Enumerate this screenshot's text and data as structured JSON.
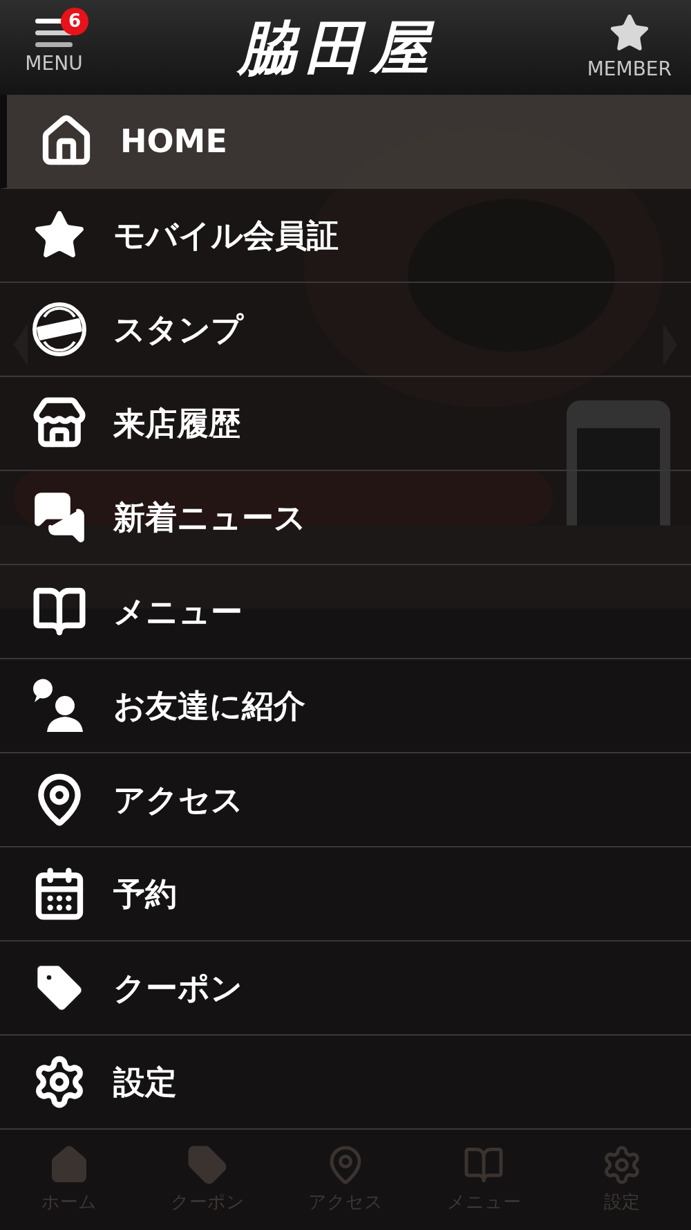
{
  "header": {
    "menu_label": "MENU",
    "badge": "6",
    "logo": "脇田屋",
    "member_label": "MEMBER"
  },
  "menu": [
    {
      "kind": "home",
      "label": "HOME",
      "selected": true
    },
    {
      "kind": "card",
      "label": "モバイル会員証",
      "selected": false
    },
    {
      "kind": "stamp",
      "label": "スタンプ",
      "selected": false
    },
    {
      "kind": "visits",
      "label": "来店履歴",
      "selected": false
    },
    {
      "kind": "news",
      "label": "新着ニュース",
      "selected": false
    },
    {
      "kind": "food",
      "label": "メニュー",
      "selected": false
    },
    {
      "kind": "friends",
      "label": "お友達に紹介",
      "selected": false
    },
    {
      "kind": "access",
      "label": "アクセス",
      "selected": false
    },
    {
      "kind": "reserve",
      "label": "予約",
      "selected": false
    },
    {
      "kind": "coupon",
      "label": "クーポン",
      "selected": false
    },
    {
      "kind": "settings",
      "label": "設定",
      "selected": false
    }
  ],
  "background": {
    "tabs": [
      {
        "kind": "home",
        "label": "ホーム"
      },
      {
        "kind": "coupon",
        "label": "クーポン"
      },
      {
        "kind": "access",
        "label": "アクセス"
      },
      {
        "kind": "food",
        "label": "メニュー"
      },
      {
        "kind": "settings",
        "label": "設定"
      }
    ]
  }
}
